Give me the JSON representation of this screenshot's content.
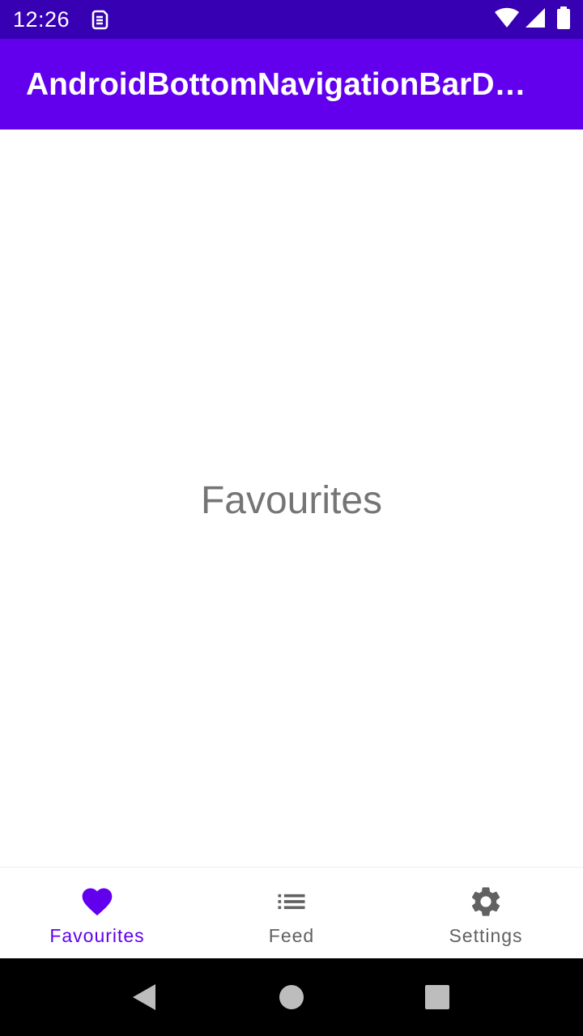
{
  "status_bar": {
    "time": "12:26",
    "notification_icon": "sim-notification-icon",
    "wifi_icon": "wifi-icon",
    "signal_icon": "cell-signal-icon",
    "battery_icon": "battery-icon"
  },
  "app_bar": {
    "title": "AndroidBottomNavigationBarDemo"
  },
  "content": {
    "label": "Favourites"
  },
  "bottom_nav": {
    "items": [
      {
        "label": "Favourites",
        "icon": "heart-icon",
        "active": true
      },
      {
        "label": "Feed",
        "icon": "list-icon",
        "active": false
      },
      {
        "label": "Settings",
        "icon": "gear-icon",
        "active": false
      }
    ]
  },
  "system_nav": {
    "back_icon": "back-triangle-icon",
    "home_icon": "home-circle-icon",
    "recents_icon": "recents-square-icon"
  },
  "colors": {
    "status_bar": "#3700B3",
    "primary": "#6200EE",
    "inactive": "#616161",
    "content_text": "#757575",
    "system_nav": "#000000"
  }
}
